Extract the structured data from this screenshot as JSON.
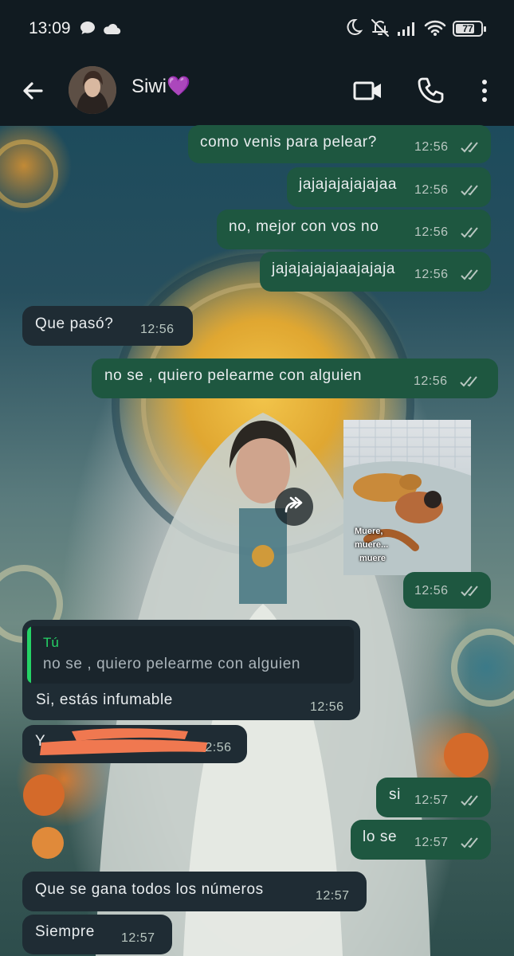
{
  "status_bar": {
    "time": "13:09",
    "battery": "77",
    "battery_level": 0.77,
    "icons": [
      "chat-bubble-icon",
      "cloud-icon",
      "moon-icon",
      "bell-off-icon",
      "signal-icon",
      "wifi-icon",
      "battery-icon"
    ]
  },
  "header": {
    "contact_name": "Siwi💜",
    "icons": [
      "back-arrow-icon",
      "video-call-icon",
      "phone-icon",
      "more-options-icon"
    ]
  },
  "colors": {
    "header_bg": "#111b21",
    "outgoing_bubble": "#1e5740",
    "incoming_bubble": "#1f2c34",
    "read_ticks": "#b9c7c1",
    "reply_accent": "#25d366"
  },
  "messages": [
    {
      "direction": "out",
      "text": "como venis para pelear?",
      "time": "12:56",
      "read": true
    },
    {
      "direction": "out",
      "text": "jajajajajajajaa",
      "time": "12:56",
      "read": true
    },
    {
      "direction": "out",
      "text": "no, mejor con vos no",
      "time": "12:56",
      "read": true
    },
    {
      "direction": "out",
      "text": "jajajajajajaajajaja",
      "time": "12:56",
      "read": true
    },
    {
      "direction": "in",
      "text": "Que pasó?",
      "time": "12:56"
    },
    {
      "direction": "out",
      "text": "no se , quiero pelearme con alguien",
      "time": "12:56",
      "read": true
    },
    {
      "direction": "out",
      "type": "video",
      "caption": [
        "Muere,",
        "muere...",
        "muere"
      ],
      "time": "12:56",
      "read": true
    },
    {
      "direction": "in",
      "reply_to": {
        "author": "Tú",
        "text": "no se , quiero pelearme con alguien"
      },
      "text": "Si, estás infumable",
      "time": "12:56"
    },
    {
      "direction": "in",
      "text": "Y",
      "time": "12:56",
      "redacted": true
    },
    {
      "direction": "out",
      "text": "si",
      "time": "12:57",
      "read": true
    },
    {
      "direction": "out",
      "text": "lo se",
      "time": "12:57",
      "read": true
    },
    {
      "direction": "in",
      "text": "Que se gana todos los números",
      "time": "12:57"
    },
    {
      "direction": "in",
      "text": "Siempre",
      "time": "12:57"
    }
  ]
}
